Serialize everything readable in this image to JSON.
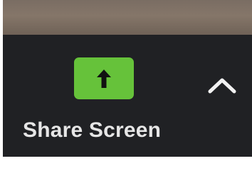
{
  "toolbar": {
    "share_button": {
      "label": "Share Screen",
      "icon": "arrow-up-icon",
      "icon_bg_color": "#66c23a"
    },
    "options_chevron": {
      "icon": "chevron-up-icon"
    },
    "background_color": "#202124"
  }
}
